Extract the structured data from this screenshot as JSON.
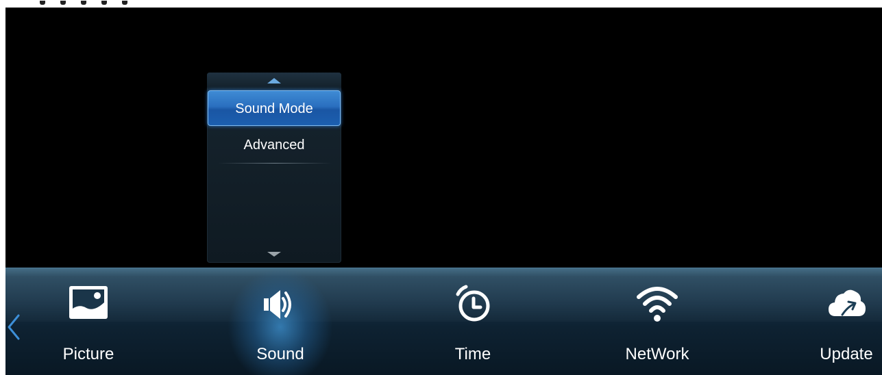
{
  "menu": {
    "items": [
      {
        "label": "Sound Mode",
        "selected": true
      },
      {
        "label": "Advanced",
        "selected": false
      }
    ]
  },
  "navbar": {
    "items": [
      {
        "label": "Picture",
        "icon": "picture-icon"
      },
      {
        "label": "Sound",
        "icon": "speaker-icon",
        "active": true
      },
      {
        "label": "Time",
        "icon": "clock-icon"
      },
      {
        "label": "NetWork",
        "icon": "wifi-icon"
      },
      {
        "label": "Update",
        "icon": "cloud-upload-icon"
      }
    ]
  },
  "colors": {
    "accent": "#2a6fbf",
    "nav_arrow": "#3d8fd8"
  }
}
